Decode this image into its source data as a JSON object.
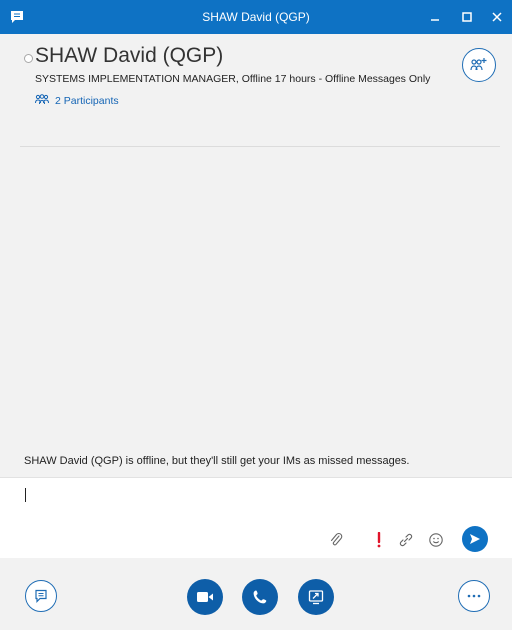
{
  "window": {
    "title": "SHAW David (QGP)",
    "accent_color": "#0e72c4"
  },
  "contact": {
    "name": "SHAW David (QGP)",
    "job_title": "SYSTEMS IMPLEMENTATION MANAGER",
    "separator": ",",
    "status": "Offline 17 hours - Offline Messages Only",
    "presence": "offline",
    "participants_label": "2 Participants"
  },
  "conversation": {
    "system_message": "SHAW David (QGP) is offline, but they'll still get your IMs as missed messages."
  },
  "compose": {
    "value": "",
    "tools": [
      "paperclip-icon",
      "exclamation-icon",
      "link-icon",
      "smiley-icon",
      "send-icon"
    ]
  },
  "bottom_bar": {
    "buttons": [
      "im-icon",
      "video-icon",
      "phone-icon",
      "share-screen-icon",
      "more-options-icon"
    ]
  }
}
